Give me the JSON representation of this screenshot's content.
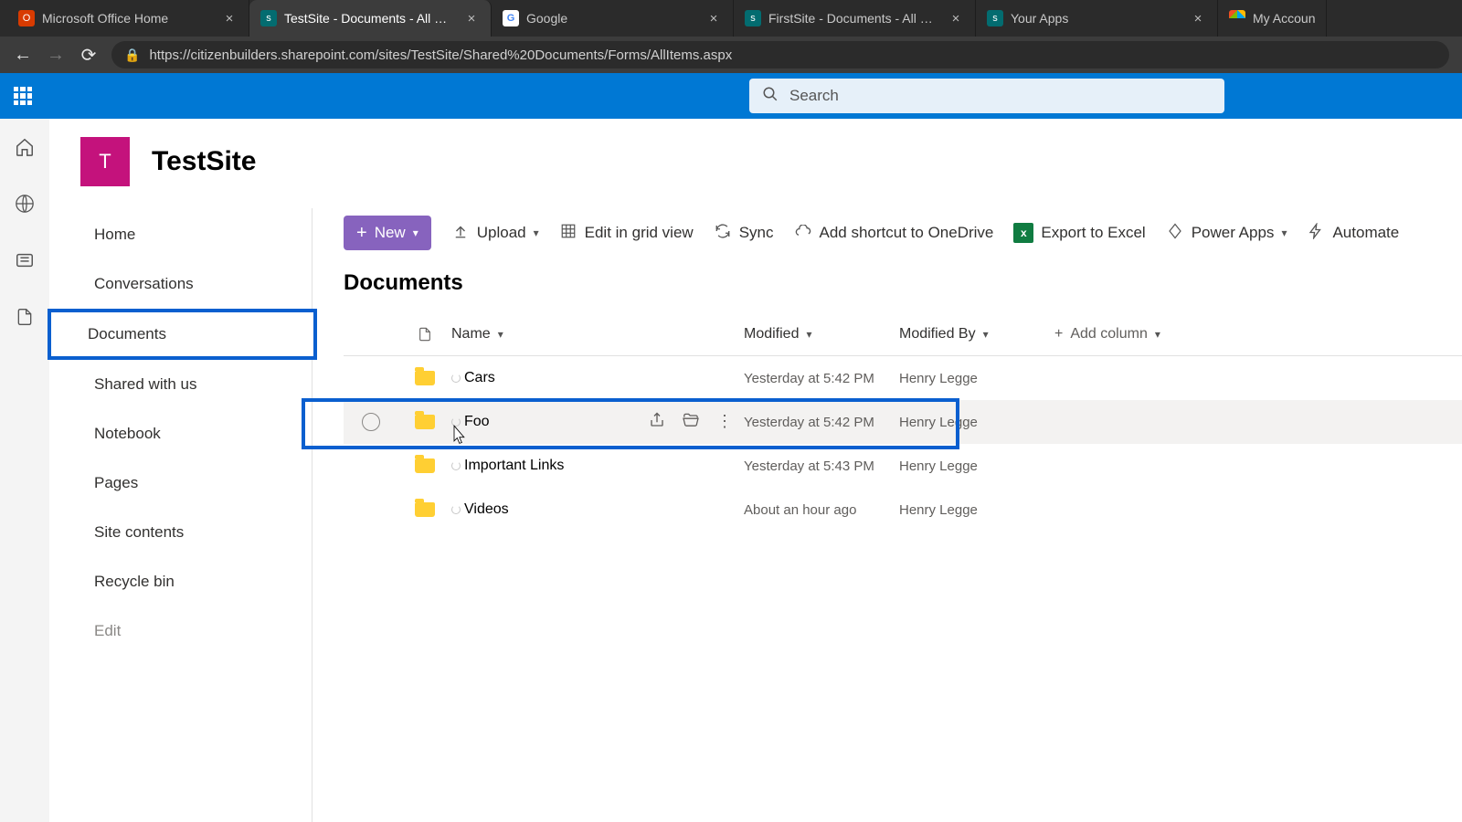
{
  "browser": {
    "tabs": [
      {
        "title": "Microsoft Office Home",
        "favicon": "office"
      },
      {
        "title": "TestSite - Documents - All Docum",
        "favicon": "sharepoint",
        "active": true
      },
      {
        "title": "Google",
        "favicon": "google"
      },
      {
        "title": "FirstSite - Documents - All Docum",
        "favicon": "sharepoint"
      },
      {
        "title": "Your Apps",
        "favicon": "sharepoint"
      },
      {
        "title": "My Accoun",
        "favicon": "windows",
        "trail": true
      }
    ],
    "url": "https://citizenbuilders.sharepoint.com/sites/TestSite/Shared%20Documents/Forms/AllItems.aspx"
  },
  "suite": {
    "search_placeholder": "Search"
  },
  "site": {
    "logo_initial": "T",
    "title": "TestSite"
  },
  "left_nav": {
    "items": [
      {
        "label": "Home"
      },
      {
        "label": "Conversations"
      },
      {
        "label": "Documents",
        "selected": true
      },
      {
        "label": "Shared with us"
      },
      {
        "label": "Notebook"
      },
      {
        "label": "Pages"
      },
      {
        "label": "Site contents"
      },
      {
        "label": "Recycle bin"
      }
    ],
    "edit_label": "Edit"
  },
  "command_bar": {
    "new_label": "New",
    "upload_label": "Upload",
    "edit_grid_label": "Edit in grid view",
    "sync_label": "Sync",
    "onedrive_label": "Add shortcut to OneDrive",
    "excel_label": "Export to Excel",
    "powerapps_label": "Power Apps",
    "automate_label": "Automate"
  },
  "library": {
    "title": "Documents",
    "columns": {
      "name": "Name",
      "modified": "Modified",
      "modified_by": "Modified By",
      "add_column": "Add column"
    },
    "rows": [
      {
        "name": "Cars",
        "modified": "Yesterday at 5:42 PM",
        "modified_by": "Henry Legge"
      },
      {
        "name": "Foo",
        "modified": "Yesterday at 5:42 PM",
        "modified_by": "Henry Legge",
        "hovered": true
      },
      {
        "name": "Important Links",
        "modified": "Yesterday at 5:43 PM",
        "modified_by": "Henry Legge"
      },
      {
        "name": "Videos",
        "modified": "About an hour ago",
        "modified_by": "Henry Legge"
      }
    ]
  }
}
